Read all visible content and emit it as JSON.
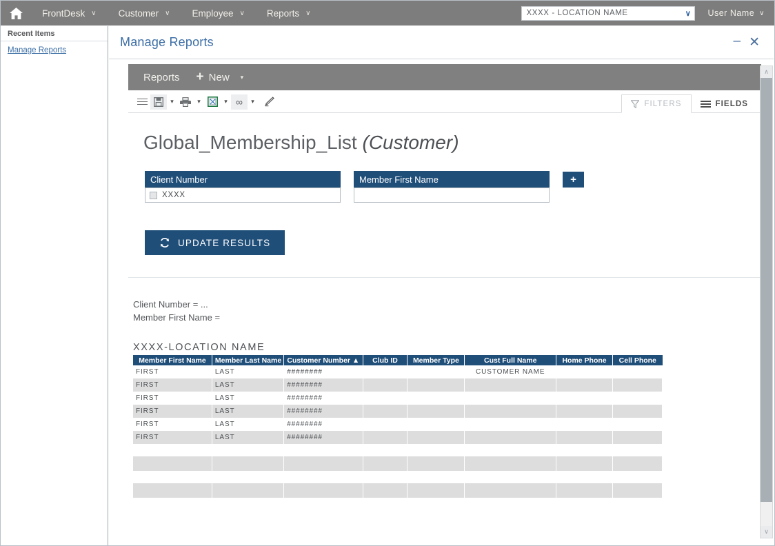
{
  "topnav": {
    "home_icon": "home-icon",
    "items": [
      {
        "label": "FrontDesk",
        "caret": "∨"
      },
      {
        "label": "Customer",
        "caret": "∨"
      },
      {
        "label": "Employee",
        "caret": "∨"
      },
      {
        "label": "Reports",
        "caret": "∨"
      }
    ],
    "location_select": {
      "value": "XXXX - LOCATION NAME",
      "caret": "∨"
    },
    "user_menu": {
      "label": "User Name",
      "caret": "∨"
    }
  },
  "sidebar": {
    "heading": "Recent Items",
    "links": [
      {
        "label": "Manage Reports"
      }
    ]
  },
  "page": {
    "title": "Manage Reports",
    "minimize_label": "–",
    "close_label": "✕"
  },
  "report_bar": {
    "reports_label": "Reports",
    "new_label": "New",
    "new_plus": "+",
    "caret": "▾"
  },
  "icon_bar": {
    "icons": [
      {
        "name": "list-menu-icon",
        "caret": false
      },
      {
        "name": "save-icon",
        "caret": true
      },
      {
        "name": "print-icon",
        "caret": true
      },
      {
        "name": "excel-export-icon",
        "caret": true
      },
      {
        "name": "infinity-icon",
        "caret": true
      },
      {
        "name": "edit-pencil-icon",
        "caret": false
      }
    ],
    "tabs": [
      {
        "label": "FILTERS",
        "icon": "funnel-icon",
        "active": true
      },
      {
        "label": "FIELDS",
        "icon": "list-lines-icon",
        "active": false
      }
    ]
  },
  "report": {
    "name": "Global_Membership_List",
    "entity": "(Customer)",
    "filters": [
      {
        "label": "Client Number",
        "value": "XXXX",
        "has_checkbox": true,
        "placeholder": ""
      },
      {
        "label": "Member First Name",
        "value": "",
        "has_checkbox": false,
        "placeholder": ""
      }
    ],
    "add_filter_label": "+",
    "update_button": {
      "label": "UPDATE RESULTS",
      "icon": "refresh-icon"
    },
    "criteria": [
      "Client Number = ...",
      "Member First Name ="
    ]
  },
  "results": {
    "location_heading": "XXXX-LOCATION NAME",
    "columns": [
      {
        "label": "Member First Name",
        "width": 113
      },
      {
        "label": "Member Last Name",
        "width": 103
      },
      {
        "label": "Customer Number ▲",
        "width": 113,
        "sorted": "asc"
      },
      {
        "label": "Club ID",
        "width": 64
      },
      {
        "label": "Member Type",
        "width": 82
      },
      {
        "label": "Cust Full Name",
        "width": 131
      },
      {
        "label": "Home Phone",
        "width": 81
      },
      {
        "label": "Cell Phone",
        "width": 71
      }
    ],
    "rows": [
      {
        "style": "plain",
        "cells": [
          "FIRST",
          "LAST",
          "########",
          "",
          "",
          "CUSTOMER NAME",
          "",
          ""
        ]
      },
      {
        "style": "alt",
        "cells": [
          "FIRST",
          "LAST",
          "########",
          "",
          "",
          "",
          "",
          ""
        ]
      },
      {
        "style": "plain",
        "cells": [
          "FIRST",
          "LAST",
          "########",
          "",
          "",
          "",
          "",
          ""
        ]
      },
      {
        "style": "alt",
        "cells": [
          "FIRST",
          "LAST",
          "########",
          "",
          "",
          "",
          "",
          ""
        ]
      },
      {
        "style": "plain",
        "cells": [
          "FIRST",
          "LAST",
          "########",
          "",
          "",
          "",
          "",
          ""
        ]
      },
      {
        "style": "alt",
        "cells": [
          "FIRST",
          "LAST",
          "########",
          "",
          "",
          "",
          "",
          ""
        ]
      },
      {
        "style": "gap",
        "cells": [
          "",
          "",
          "",
          "",
          "",
          "",
          "",
          ""
        ]
      },
      {
        "style": "alt",
        "cells": [
          "",
          "",
          "",
          "",
          "",
          "",
          "",
          ""
        ]
      },
      {
        "style": "gap",
        "cells": [
          "",
          "",
          "",
          "",
          "",
          "",
          "",
          ""
        ]
      },
      {
        "style": "alt",
        "cells": [
          "",
          "",
          "",
          "",
          "",
          "",
          "",
          ""
        ]
      }
    ]
  },
  "scrollbar": {
    "up_arrow": "∧",
    "down_arrow": "∨"
  },
  "colors": {
    "nav_gray": "#7d7d7d",
    "report_bar_gray": "#808080",
    "brand_blue": "#1f4e79",
    "link_blue": "#3b6ea5",
    "title_blue": "#3c6ea6",
    "row_alt": "#dddddd",
    "excel_green": "#1f7a44"
  }
}
